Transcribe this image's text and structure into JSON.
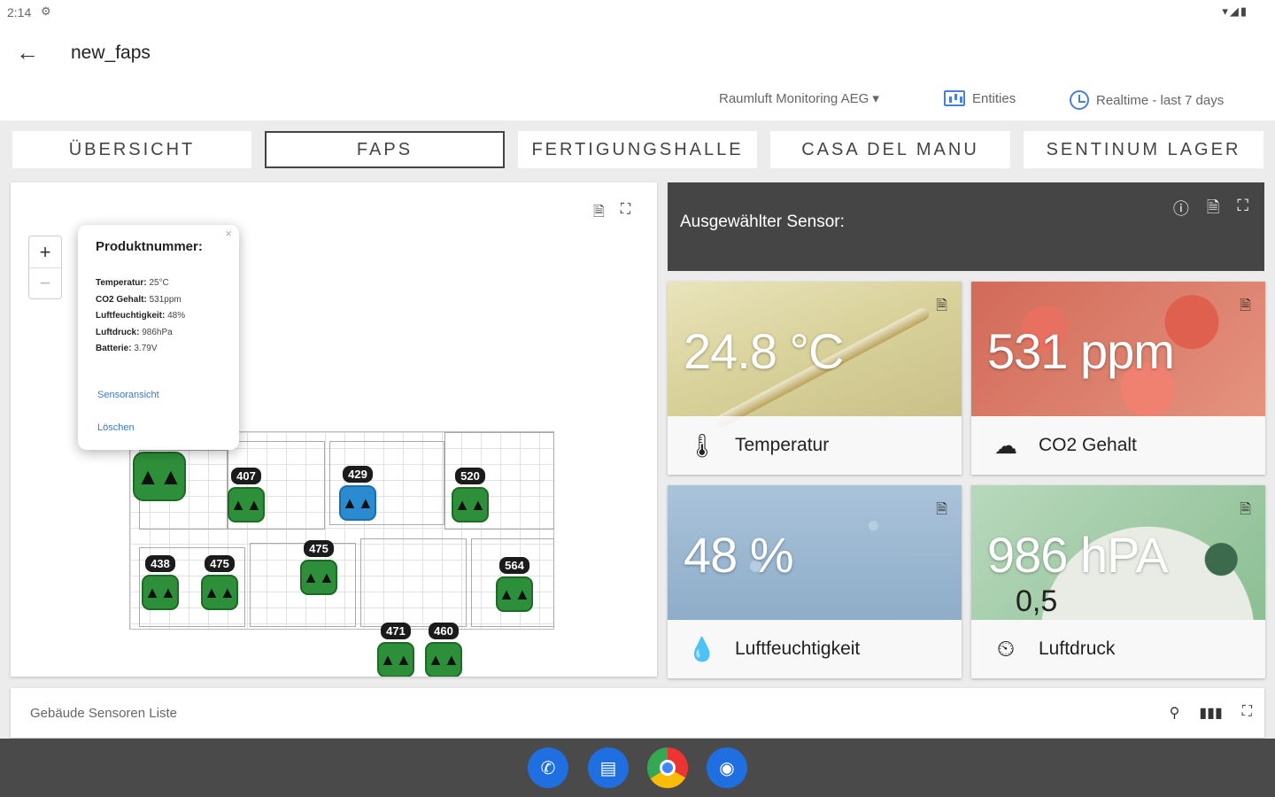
{
  "status": {
    "time": "2:14",
    "icons": "▾◢▮"
  },
  "appbar": {
    "title": "new_faps"
  },
  "toolbar": {
    "dashboard": "Raumluft Monitoring AEG ▾",
    "entities": "Entities",
    "realtime": "Realtime - last 7 days"
  },
  "tabs": [
    "ÜBERSICHT",
    "FAPS",
    "FERTIGUNGSHALLE",
    "CASA DEL MANU",
    "SENTINUM LAGER"
  ],
  "map": {
    "zoom_in": "+",
    "zoom_out": "−",
    "popup": {
      "title": "Produktnummer:",
      "rows": [
        {
          "k": "Temperatur:",
          "v": " 25°C"
        },
        {
          "k": "CO2 Gehalt:",
          "v": " 531ppm"
        },
        {
          "k": "Luftfeuchtigkeit:",
          "v": " 48%"
        },
        {
          "k": "Luftdruck:",
          "v": " 986hPa"
        },
        {
          "k": "Batterie:",
          "v": " 3.79V"
        }
      ],
      "link1": "Sensoransicht",
      "link2": "Löschen"
    },
    "markers": [
      "407",
      "429",
      "520",
      "438",
      "475",
      "475",
      "564",
      "471",
      "460"
    ]
  },
  "sensor": {
    "header": "Ausgewählter Sensor:"
  },
  "cards": {
    "temp": {
      "value": "24.8 °C",
      "label": "Temperatur"
    },
    "co2": {
      "value": "531 ppm",
      "label": "CO2 Gehalt"
    },
    "hum": {
      "value": "48 %",
      "label": "Luftfeuchtigkeit"
    },
    "press": {
      "value": "986 hPA",
      "label": "Luftdruck",
      "dial": "0,5"
    }
  },
  "list": {
    "title": "Gebäude Sensoren Liste"
  },
  "colors": {
    "accent": "#4a7fd6",
    "marker_green": "#2e8f3a",
    "marker_blue": "#2a8bd0"
  }
}
